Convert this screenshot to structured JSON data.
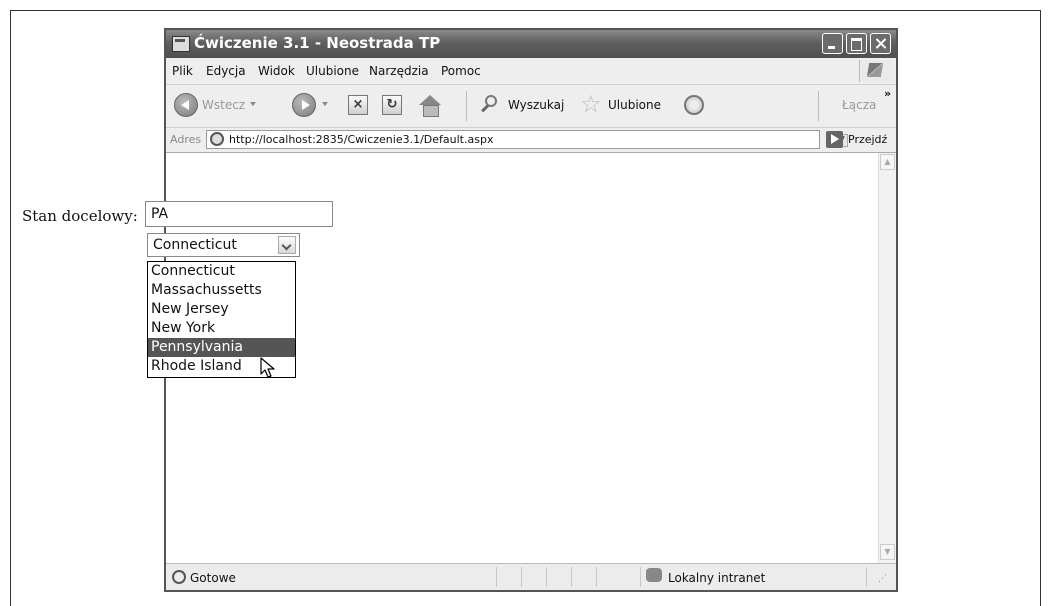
{
  "window": {
    "title": "Ćwiczenie 3.1 - Neostrada TP"
  },
  "menubar": {
    "items": [
      "Plik",
      "Edycja",
      "Widok",
      "Ulubione",
      "Narzędzia",
      "Pomoc"
    ]
  },
  "toolbar": {
    "back_label": "Wstecz",
    "search_label": "Wyszukaj",
    "favorites_label": "Ulubione",
    "links_label": "Łącza",
    "icons": [
      "back-icon",
      "forward-icon",
      "stop-icon",
      "refresh-icon",
      "home-icon",
      "search-icon",
      "favorites-star-icon",
      "media-icon"
    ]
  },
  "addressbar": {
    "label": "Adres",
    "url": "http://localhost:2835/Cwiczenie3.1/Default.aspx",
    "go_label": "Przejdź"
  },
  "form": {
    "label": "Stan docelowy:",
    "input_value": "PA",
    "select_value": "Connecticut",
    "options": [
      "Connecticut",
      "Massachussetts",
      "New Jersey",
      "New York",
      "Pennsylvania",
      "Rhode Island"
    ],
    "highlighted_option": "Pennsylvania"
  },
  "statusbar": {
    "status": "Gotowe",
    "zone": "Lokalny intranet"
  }
}
